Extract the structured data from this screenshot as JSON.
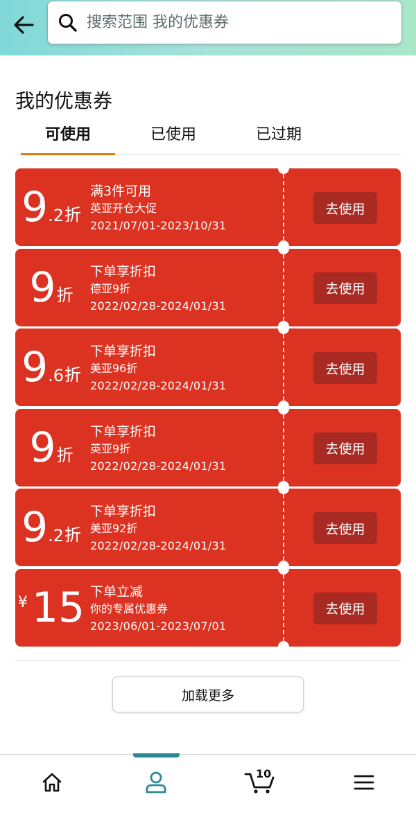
{
  "header": {
    "search_placeholder": "搜索范围 我的优惠券"
  },
  "page": {
    "title": "我的优惠券"
  },
  "tabs": [
    {
      "label": "可使用",
      "active": true
    },
    {
      "label": "已使用",
      "active": false
    },
    {
      "label": "已过期",
      "active": false
    }
  ],
  "coupons": [
    {
      "main": "9",
      "decimal": ".2",
      "unit": "折",
      "condition": "满3件可用",
      "description": "英亚开仓大促",
      "validity": "2021/07/01-2023/10/31",
      "button": "去使用"
    },
    {
      "main": "9",
      "decimal": "",
      "unit": "折",
      "condition": "下单享折扣",
      "description": "德亚9折",
      "validity": "2022/02/28-2024/01/31",
      "button": "去使用"
    },
    {
      "main": "9",
      "decimal": ".6",
      "unit": "折",
      "condition": "下单享折扣",
      "description": "美亚96折",
      "validity": "2022/02/28-2024/01/31",
      "button": "去使用"
    },
    {
      "main": "9",
      "decimal": "",
      "unit": "折",
      "condition": "下单享折扣",
      "description": "英亚9折",
      "validity": "2022/02/28-2024/01/31",
      "button": "去使用"
    },
    {
      "main": "9",
      "decimal": ".2",
      "unit": "折",
      "condition": "下单享折扣",
      "description": "美亚92折",
      "validity": "2022/02/28-2024/01/31",
      "button": "去使用"
    },
    {
      "currency": "¥",
      "main": "15",
      "condition": "下单立减",
      "description": "你的专属优惠券",
      "validity": "2023/06/01-2023/07/01",
      "button": "去使用"
    }
  ],
  "load_more": "加载更多",
  "bottom_nav": {
    "items": [
      {
        "icon": "home-icon"
      },
      {
        "icon": "profile-icon",
        "active": true
      },
      {
        "icon": "cart-icon"
      },
      {
        "icon": "menu-icon"
      }
    ],
    "cart_count": "10"
  },
  "colors": {
    "coupon_red": "#dc3221",
    "button_dark_red": "#a82a22",
    "tab_underline": "#e47911",
    "nav_active": "#2b8a94"
  }
}
